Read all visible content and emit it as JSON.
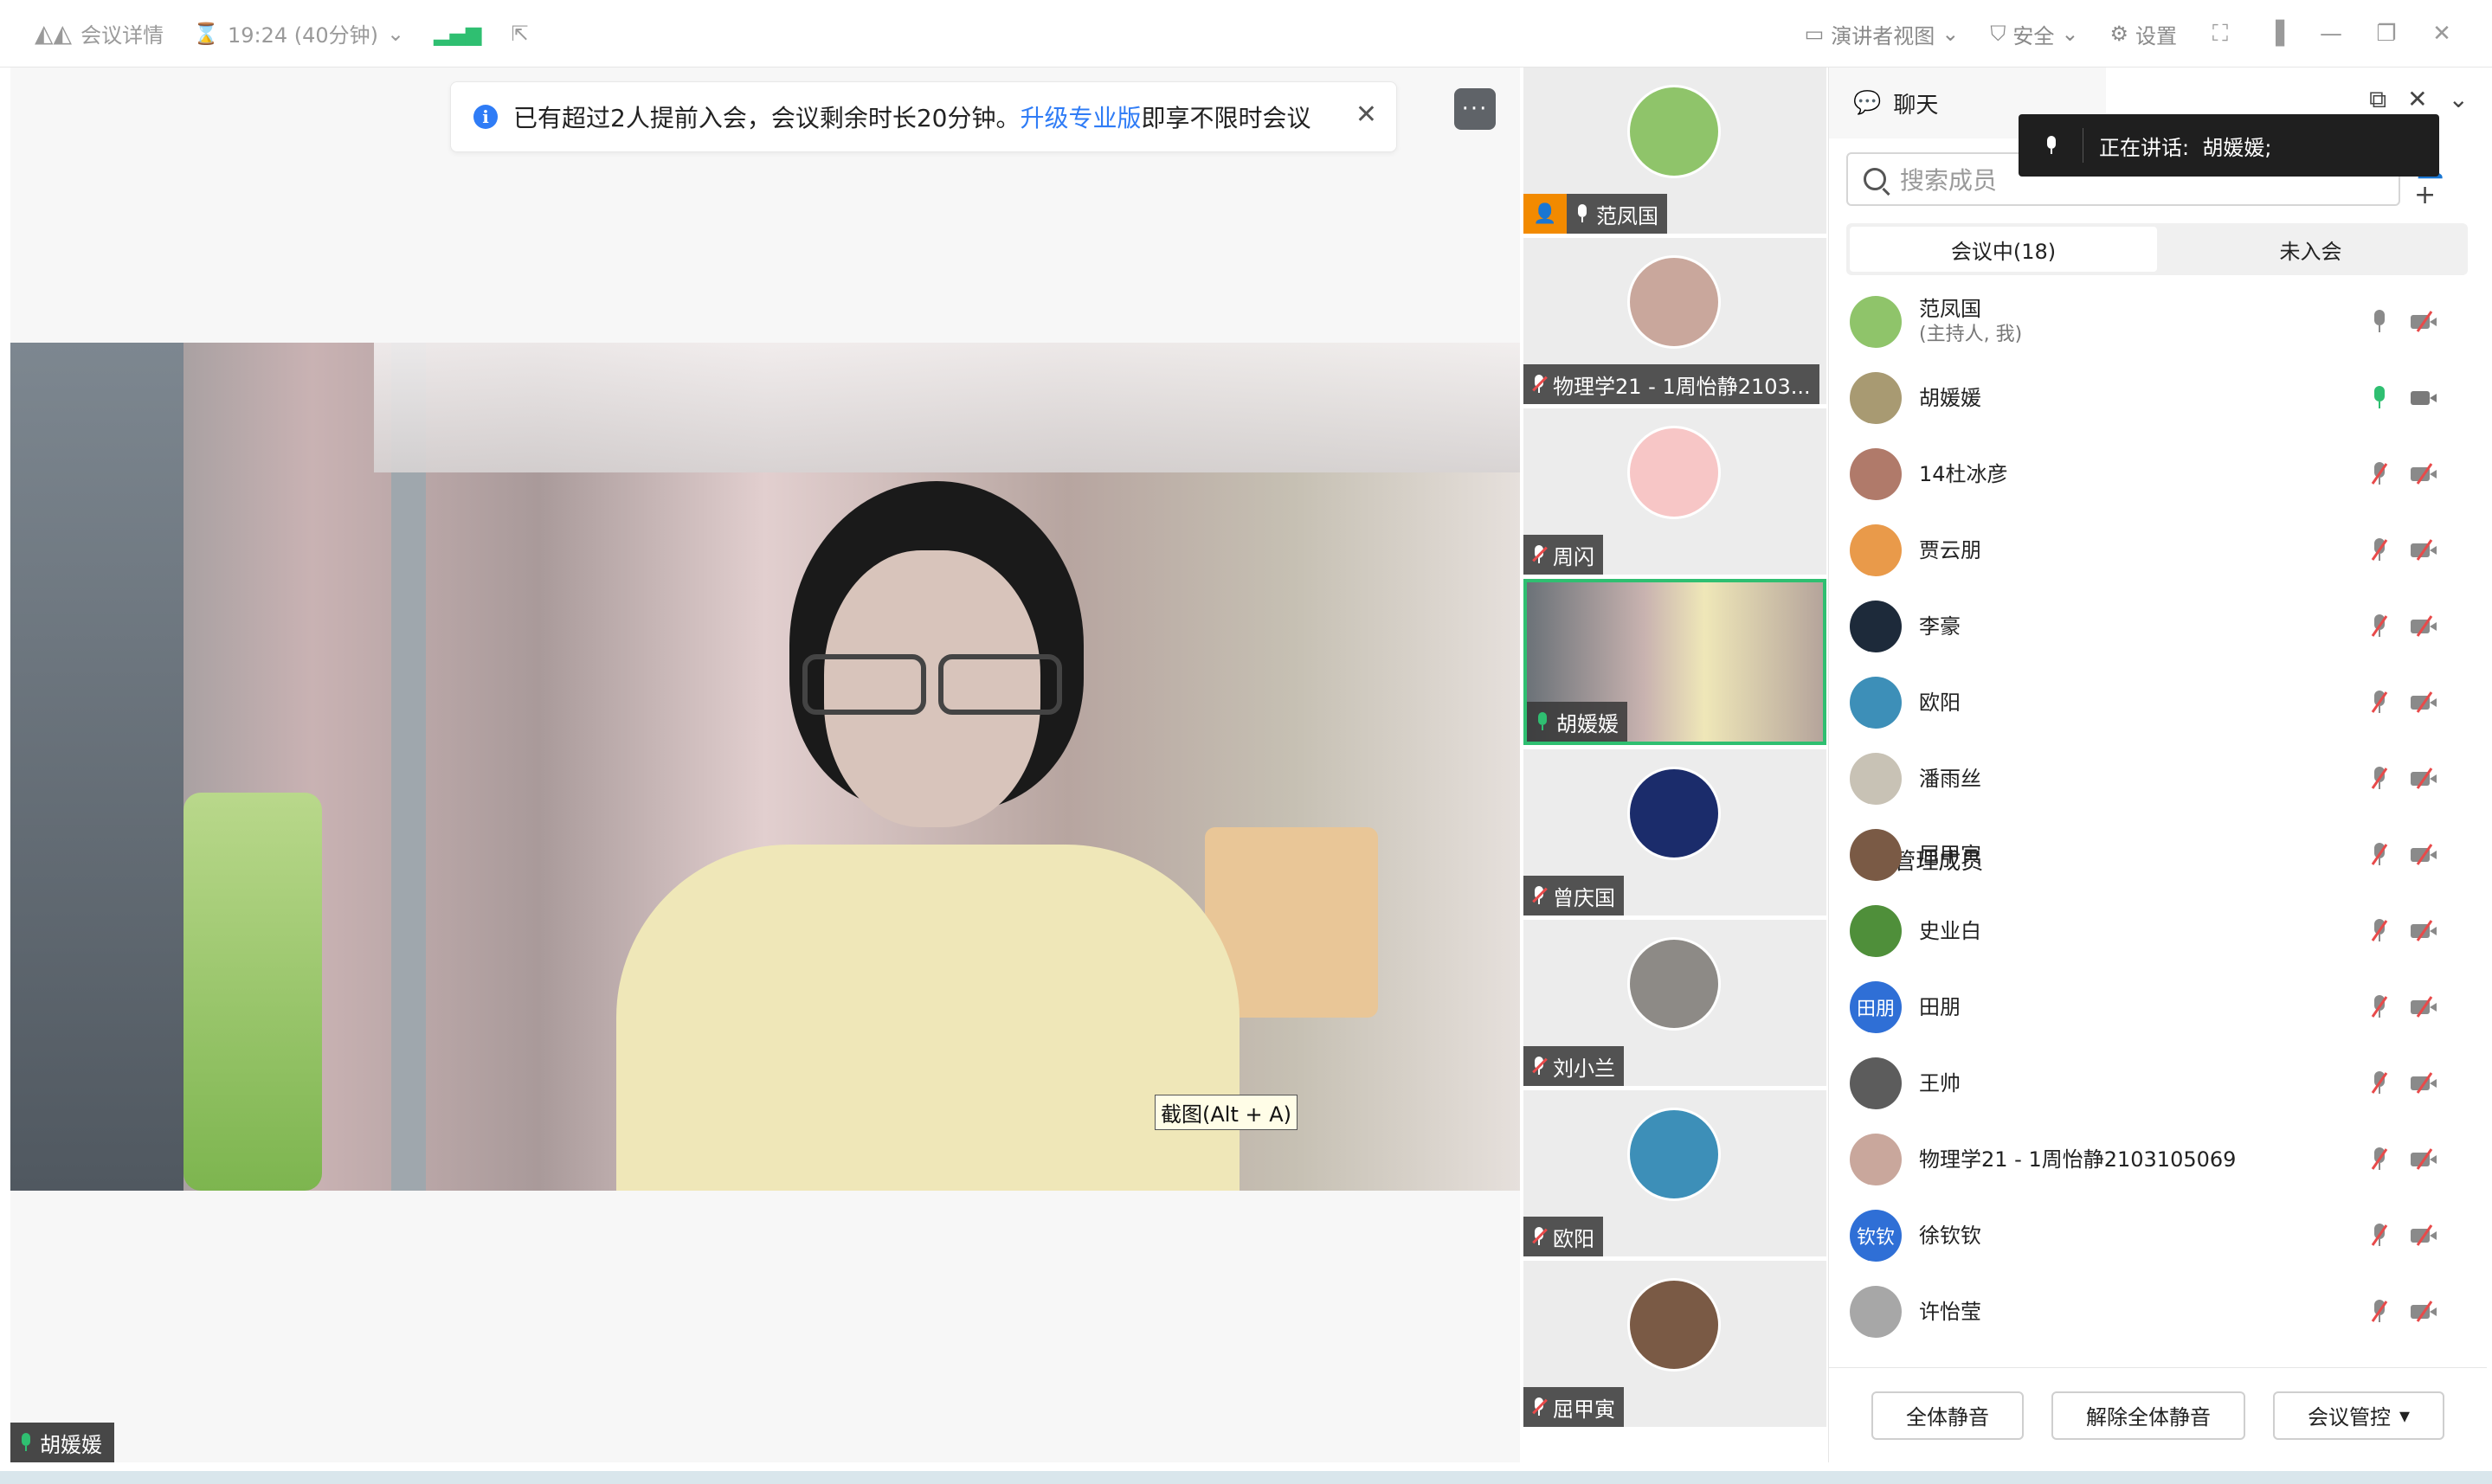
{
  "titlebar": {
    "meeting_details": "会议详情",
    "time": "19:24 (40分钟)",
    "presenter_view": "演讲者视图",
    "security": "安全",
    "settings": "设置"
  },
  "notice": {
    "text_before": "已有超过2人提前入会，会议剩余时长20分钟。",
    "link": "升级专业版",
    "text_after": "即享不限时会议"
  },
  "main_video": {
    "speaker_name": "胡媛媛",
    "screenshot_tooltip": "截图(Alt + A)"
  },
  "thumbnails": [
    {
      "name": "范凤国",
      "host": true,
      "muted": false,
      "color": "#8fc46a"
    },
    {
      "name": "物理学21 - 1周怡静2103...",
      "host": false,
      "muted": true,
      "color": "#c9a79c"
    },
    {
      "name": "周闪",
      "host": false,
      "muted": true,
      "color": "#f7c6c6"
    },
    {
      "name": "胡媛媛",
      "host": false,
      "muted": false,
      "active": true,
      "color": "#efe7b8"
    },
    {
      "name": "曾庆国",
      "host": false,
      "muted": true,
      "color": "#1b2c6b"
    },
    {
      "name": "刘小兰",
      "host": false,
      "muted": true,
      "color": "#8d8a86"
    },
    {
      "name": "欧阳",
      "host": false,
      "muted": true,
      "color": "#3d8fb8"
    },
    {
      "name": "屈甲寅",
      "host": false,
      "muted": true,
      "color": "#7a5a45"
    }
  ],
  "panel": {
    "tab_chat": "聊天",
    "tab_members": "管理成员",
    "speaking_label": "正在讲话:",
    "speaking_name": "胡媛媛;",
    "search_placeholder": "搜索成员",
    "seg_in_meeting": "会议中(18)",
    "seg_not_joined": "未入会",
    "members": [
      {
        "name": "范凤国",
        "sub": "(主持人, 我)",
        "mic": "on",
        "cam": "off",
        "color": "#8fc46a",
        "initials": ""
      },
      {
        "name": "胡媛媛",
        "sub": "",
        "mic": "speaking",
        "cam": "on",
        "color": "#a89a72",
        "initials": ""
      },
      {
        "name": "14杜冰彦",
        "sub": "",
        "mic": "off",
        "cam": "off",
        "color": "#b07a6a",
        "initials": ""
      },
      {
        "name": "贾云朋",
        "sub": "",
        "mic": "off",
        "cam": "off",
        "color": "#e99a4a",
        "initials": ""
      },
      {
        "name": "李豪",
        "sub": "",
        "mic": "off",
        "cam": "off",
        "color": "#1d2a3a",
        "initials": ""
      },
      {
        "name": "欧阳",
        "sub": "",
        "mic": "off",
        "cam": "off",
        "color": "#3d8fb8",
        "initials": ""
      },
      {
        "name": "潘雨丝",
        "sub": "",
        "mic": "off",
        "cam": "off",
        "color": "#c8c2b5",
        "initials": ""
      },
      {
        "name": "屈甲寅",
        "sub": "",
        "mic": "off",
        "cam": "off",
        "color": "#7a5a45",
        "initials": ""
      },
      {
        "name": "史业白",
        "sub": "",
        "mic": "off",
        "cam": "off",
        "color": "#4f8f3a",
        "initials": ""
      },
      {
        "name": "田朋",
        "sub": "",
        "mic": "off",
        "cam": "off",
        "color": "#2f6fd6",
        "initials": "田朋"
      },
      {
        "name": "王帅",
        "sub": "",
        "mic": "off",
        "cam": "off",
        "color": "#5c5c5c",
        "initials": ""
      },
      {
        "name": "物理学21 - 1周怡静2103105069",
        "sub": "",
        "mic": "off",
        "cam": "off",
        "color": "#c9a79c",
        "initials": ""
      },
      {
        "name": "徐钦钦",
        "sub": "",
        "mic": "off",
        "cam": "off",
        "color": "#2f6fd6",
        "initials": "钦钦"
      },
      {
        "name": "许怡莹",
        "sub": "",
        "mic": "off",
        "cam": "off",
        "color": "#a7a7a7",
        "initials": ""
      }
    ],
    "btn_mute_all": "全体静音",
    "btn_unmute_all": "解除全体静音",
    "btn_meeting_control": "会议管控"
  }
}
